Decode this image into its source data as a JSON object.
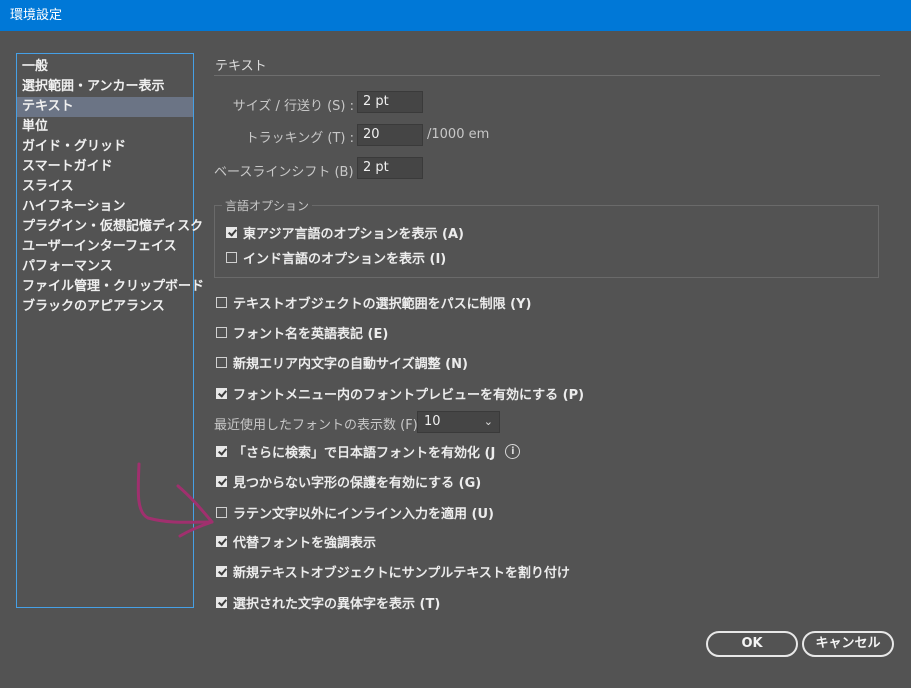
{
  "window": {
    "title": "環境設定"
  },
  "sidebar": {
    "items": [
      {
        "label": "一般"
      },
      {
        "label": "選択範囲・アンカー表示"
      },
      {
        "label": "テキスト"
      },
      {
        "label": "単位"
      },
      {
        "label": "ガイド・グリッド"
      },
      {
        "label": "スマートガイド"
      },
      {
        "label": "スライス"
      },
      {
        "label": "ハイフネーション"
      },
      {
        "label": "プラグイン・仮想記憶ディスク"
      },
      {
        "label": "ユーザーインターフェイス"
      },
      {
        "label": "パフォーマンス"
      },
      {
        "label": "ファイル管理・クリップボード"
      },
      {
        "label": "ブラックのアピアランス"
      }
    ],
    "selected": "テキスト"
  },
  "panel": {
    "title": "テキスト",
    "size_leading": {
      "label": "サイズ / 行送り (S) :",
      "value": "2 pt"
    },
    "tracking": {
      "label": "トラッキング (T) :",
      "value": "20",
      "unit": "/1000 em"
    },
    "baseline_shift": {
      "label": "ベースラインシフト (B) :",
      "value": "2 pt"
    },
    "language_options": {
      "legend": "言語オプション",
      "east_asian": {
        "label": "東アジア言語のオプションを表示 (A)",
        "checked": true
      },
      "indic": {
        "label": "インド言語のオプションを表示 (I)",
        "checked": false
      }
    },
    "options": [
      {
        "label": "テキストオブジェクトの選択範囲をパスに制限 (Y)",
        "checked": false
      },
      {
        "label": "フォント名を英語表記 (E)",
        "checked": false
      },
      {
        "label": "新規エリア内文字の自動サイズ調整 (N)",
        "checked": false
      },
      {
        "label": "フォントメニュー内のフォントプレビューを有効にする (P)",
        "checked": true
      }
    ],
    "recent_fonts": {
      "label": "最近使用したフォントの表示数 (F) :",
      "value": "10"
    },
    "options2": [
      {
        "label": "「さらに検索」で日本語フォントを有効化 (J",
        "checked": true,
        "info": true
      },
      {
        "label": "見つからない字形の保護を有効にする (G)",
        "checked": true
      },
      {
        "label": "ラテン文字以外にインライン入力を適用 (U)",
        "checked": false
      },
      {
        "label": "代替フォントを強調表示",
        "checked": true
      },
      {
        "label": "新規テキストオブジェクトにサンプルテキストを割り付け",
        "checked": true
      },
      {
        "label": "選択された文字の異体字を表示 (T)",
        "checked": true
      }
    ]
  },
  "buttons": {
    "ok": "OK",
    "cancel": "キャンセル"
  },
  "colors": {
    "titlebar": "#0078d7",
    "background": "#535353",
    "annotation": "#a0306e",
    "focus_border": "#46a0e6"
  }
}
